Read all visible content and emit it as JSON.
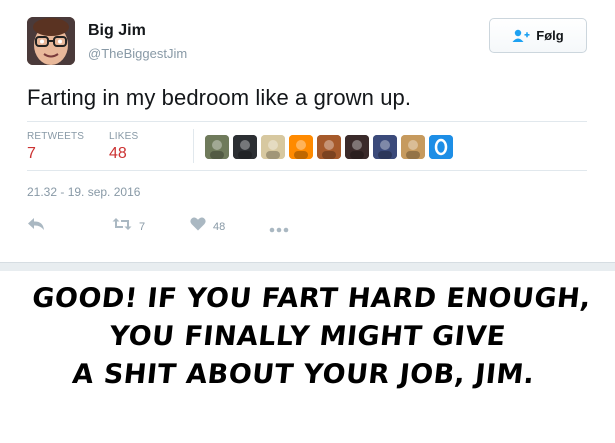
{
  "user": {
    "name": "Big Jim",
    "handle": "@TheBiggestJim"
  },
  "follow_label": "Følg",
  "tweet_text": "Farting in my bedroom like a grown up.",
  "stats": {
    "retweets_label": "RETWEETS",
    "retweets_value": "7",
    "likes_label": "LIKES",
    "likes_value": "48"
  },
  "likers": [
    {
      "icon": "avatar-1",
      "color": "#6f7a5b"
    },
    {
      "icon": "avatar-2",
      "color": "#2c2f33"
    },
    {
      "icon": "avatar-3",
      "color": "#d7c8a0"
    },
    {
      "icon": "avatar-4",
      "color": "#ff8a00"
    },
    {
      "icon": "avatar-5",
      "color": "#a65a2b"
    },
    {
      "icon": "avatar-6",
      "color": "#3a2a2a"
    },
    {
      "icon": "avatar-7",
      "color": "#3b4a7a"
    },
    {
      "icon": "avatar-8",
      "color": "#c69a5e"
    },
    {
      "icon": "avatar-9",
      "color": "#1d8ee6"
    }
  ],
  "timestamp": "21.32 - 19. sep. 2016",
  "actions": {
    "retweet_count": "7",
    "like_count": "48"
  },
  "caption": {
    "line1": "GOOD! IF YOU FART HARD ENOUGH,",
    "line2": "YOU FINALLY MIGHT GIVE",
    "line3": "A SHIT ABOUT YOUR JOB, JIM."
  },
  "colors": {
    "text": "#14171a",
    "muted": "#8899a6",
    "accent": "#cc3333",
    "border": "#e1e8ed"
  }
}
